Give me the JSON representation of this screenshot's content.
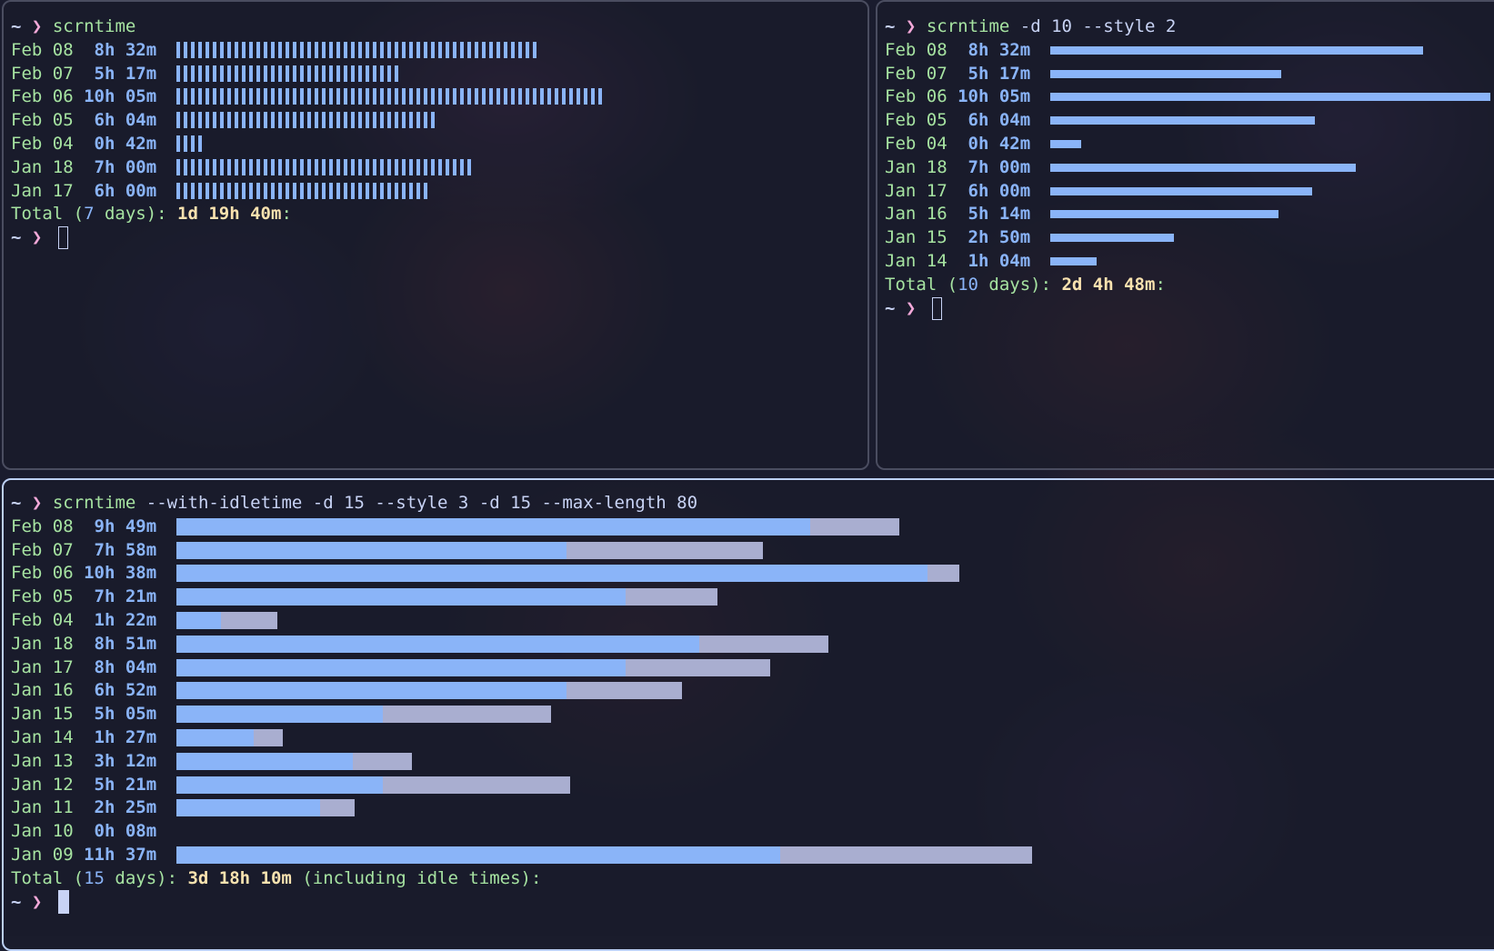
{
  "prompt": {
    "tilde": "~",
    "arrow": "❯"
  },
  "colors": {
    "used": "#8ab4f8",
    "idle": "#a9aed0",
    "date": "#a6e3a1",
    "total": "#f9e2af"
  },
  "term1": {
    "command": "scrntime",
    "args": "",
    "rows": [
      {
        "date": "Feb 08",
        "duration": " 8h 32m",
        "used_hours": 8.533
      },
      {
        "date": "Feb 07",
        "duration": " 5h 17m",
        "used_hours": 5.283
      },
      {
        "date": "Feb 06",
        "duration": "10h 05m",
        "used_hours": 10.083
      },
      {
        "date": "Feb 05",
        "duration": " 6h 04m",
        "used_hours": 6.067
      },
      {
        "date": "Feb 04",
        "duration": " 0h 42m",
        "used_hours": 0.7
      },
      {
        "date": "Jan 18",
        "duration": " 7h 00m",
        "used_hours": 7.0
      },
      {
        "date": "Jan 17",
        "duration": " 6h 00m",
        "used_hours": 6.0
      }
    ],
    "total_label": "Total (",
    "total_days": "7",
    "total_days_suffix": " days): ",
    "total_value": "1d 19h 40m",
    "total_colon": ":"
  },
  "term2": {
    "command": "scrntime",
    "args": " -d 10 --style 2",
    "rows": [
      {
        "date": "Feb 08",
        "duration": " 8h 32m",
        "used_hours": 8.533
      },
      {
        "date": "Feb 07",
        "duration": " 5h 17m",
        "used_hours": 5.283
      },
      {
        "date": "Feb 06",
        "duration": "10h 05m",
        "used_hours": 10.083
      },
      {
        "date": "Feb 05",
        "duration": " 6h 04m",
        "used_hours": 6.067
      },
      {
        "date": "Feb 04",
        "duration": " 0h 42m",
        "used_hours": 0.7
      },
      {
        "date": "Jan 18",
        "duration": " 7h 00m",
        "used_hours": 7.0
      },
      {
        "date": "Jan 17",
        "duration": " 6h 00m",
        "used_hours": 6.0
      },
      {
        "date": "Jan 16",
        "duration": " 5h 14m",
        "used_hours": 5.233
      },
      {
        "date": "Jan 15",
        "duration": " 2h 50m",
        "used_hours": 2.833
      },
      {
        "date": "Jan 14",
        "duration": " 1h 04m",
        "used_hours": 1.067
      }
    ],
    "total_label": "Total (",
    "total_days": "10",
    "total_days_suffix": " days): ",
    "total_value": "2d 4h 48m",
    "total_colon": ":"
  },
  "term3": {
    "command": "scrntime",
    "args": " --with-idletime -d 15 --style 3 -d 15 --max-length 80",
    "rows": [
      {
        "date": "Feb 08",
        "duration": " 9h 49m",
        "total_hours": 9.817,
        "used_hours": 8.6
      },
      {
        "date": "Feb 07",
        "duration": " 7h 58m",
        "total_hours": 7.967,
        "used_hours": 5.3
      },
      {
        "date": "Feb 06",
        "duration": "10h 38m",
        "total_hours": 10.633,
        "used_hours": 10.2
      },
      {
        "date": "Feb 05",
        "duration": " 7h 21m",
        "total_hours": 7.35,
        "used_hours": 6.1
      },
      {
        "date": "Feb 04",
        "duration": " 1h 22m",
        "total_hours": 1.367,
        "used_hours": 0.6
      },
      {
        "date": "Jan 18",
        "duration": " 8h 51m",
        "total_hours": 8.85,
        "used_hours": 7.1
      },
      {
        "date": "Jan 17",
        "duration": " 8h 04m",
        "total_hours": 8.067,
        "used_hours": 6.1
      },
      {
        "date": "Jan 16",
        "duration": " 6h 52m",
        "total_hours": 6.867,
        "used_hours": 5.3
      },
      {
        "date": "Jan 15",
        "duration": " 5h 05m",
        "total_hours": 5.083,
        "used_hours": 2.8
      },
      {
        "date": "Jan 14",
        "duration": " 1h 27m",
        "total_hours": 1.45,
        "used_hours": 1.05
      },
      {
        "date": "Jan 13",
        "duration": " 3h 12m",
        "total_hours": 3.2,
        "used_hours": 2.4
      },
      {
        "date": "Jan 12",
        "duration": " 5h 21m",
        "total_hours": 5.35,
        "used_hours": 2.8
      },
      {
        "date": "Jan 11",
        "duration": " 2h 25m",
        "total_hours": 2.417,
        "used_hours": 1.95
      },
      {
        "date": "Jan 10",
        "duration": " 0h 08m",
        "total_hours": 0.0,
        "used_hours": 0.0
      },
      {
        "date": "Jan 09",
        "duration": "11h 37m",
        "total_hours": 11.617,
        "used_hours": 8.2
      }
    ],
    "total_label": "Total (",
    "total_days": "15",
    "total_days_suffix": " days): ",
    "total_value": "3d 18h 10m",
    "total_suffix": " (including idle times):"
  }
}
